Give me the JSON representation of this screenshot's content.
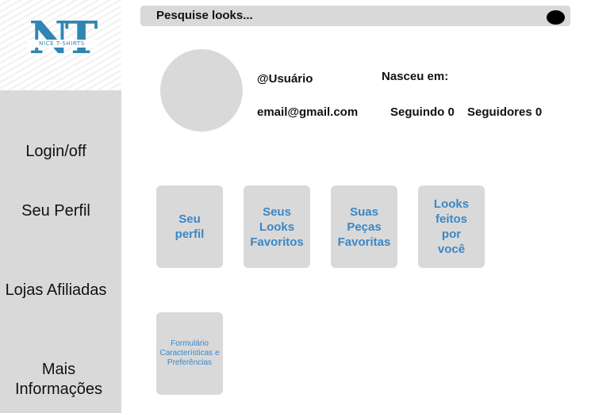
{
  "logo": {
    "letters": "NT",
    "tagline": "NICE T-SHIRTS"
  },
  "search": {
    "placeholder": "Pesquise looks..."
  },
  "sidebar": {
    "items": [
      {
        "label": "Login/off"
      },
      {
        "label": "Seu Perfil"
      },
      {
        "label": "Lojas Afiliadas"
      },
      {
        "label": "Mais Informações"
      }
    ]
  },
  "profile": {
    "username": "@Usuário",
    "email": "email@gmail.com",
    "born_label": "Nasceu em:",
    "following": "Seguindo 0",
    "followers": "Seguidores 0"
  },
  "cards": [
    {
      "label": "Seu perfil"
    },
    {
      "label": "Seus Looks Favoritos"
    },
    {
      "label": "Suas Peças Favoritas"
    },
    {
      "label": "Looks feitos por você"
    },
    {
      "label": "Formulário Características e Preferências"
    }
  ],
  "colors": {
    "accent": "#3b87c6",
    "logo": "#2f86b3",
    "panel": "#d9d9d9"
  }
}
